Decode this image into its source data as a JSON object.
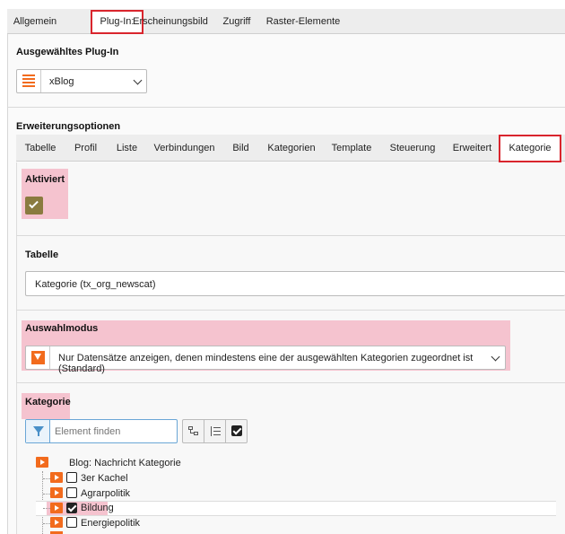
{
  "top_tabs": [
    "Allgemein",
    "Plug-In:",
    "Erscheinungsbild",
    "Zugriff",
    "Raster-Elemente"
  ],
  "plugin": {
    "heading": "Ausgewähltes Plug-In",
    "selected": "xBlog"
  },
  "extensions": {
    "heading": "Erweiterungsoptionen",
    "tabs": [
      "Tabelle",
      "Profil",
      "Liste",
      "Verbindungen",
      "Bild",
      "Kategorien",
      "Template",
      "Steuerung",
      "Erweitert",
      "Kategorie"
    ]
  },
  "aktiviert": {
    "label": "Aktiviert",
    "checked": true
  },
  "tabelle": {
    "label": "Tabelle",
    "value": "Kategorie (tx_org_newscat)"
  },
  "auswahlmodus": {
    "label": "Auswahlmodus",
    "value": "Nur Datensätze anzeigen, denen mindestens eine der ausgewählten Kategorien zugeordnet ist (Standard)"
  },
  "kategorie": {
    "label": "Kategorie",
    "search_placeholder": "Element finden",
    "root": "Blog: Nachricht Kategorie",
    "items": [
      {
        "label": "3er Kachel",
        "checked": false
      },
      {
        "label": "Agrarpolitik",
        "checked": false
      },
      {
        "label": "Bildung",
        "checked": true
      },
      {
        "label": "Energiepolitik",
        "checked": false
      }
    ]
  },
  "colors": {
    "accent_red": "#d9252d",
    "highlight": "#f5c3cf",
    "orange": "#f26b1d",
    "olive": "#8a7b3f",
    "filter_blue": "#4a90c8"
  }
}
